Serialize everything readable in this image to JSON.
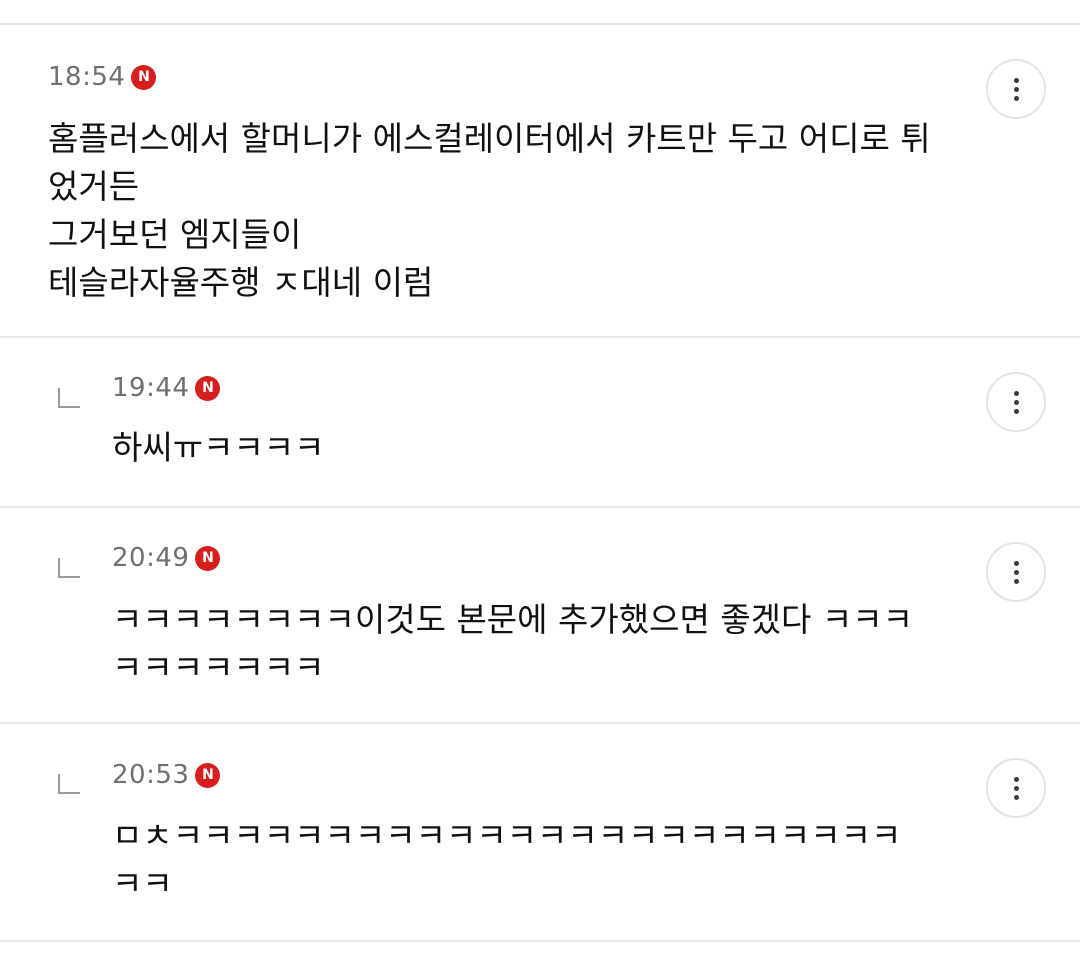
{
  "comments": [
    {
      "time": "18:54",
      "badge": "N",
      "text": "홈플러스에서 할머니가 에스컬레이터에서 카트만 두고 어디로 튀었거든\n그거보던 엠지들이\n테슬라자율주행 ㅈ대네 이럼",
      "is_reply": false
    },
    {
      "time": "19:44",
      "badge": "N",
      "text": "하씨ㅠㅋㅋㅋㅋ",
      "is_reply": true
    },
    {
      "time": "20:49",
      "badge": "N",
      "text": "ㅋㅋㅋㅋㅋㅋㅋㅋ이것도 본문에 추가했으면 좋겠다 ㅋㅋㅋㅋㅋㅋㅋㅋㅋㅋ",
      "is_reply": true
    },
    {
      "time": "20:53",
      "badge": "N",
      "text": "ㅁㅊㅋㅋㅋㅋㅋㅋㅋㅋㅋㅋㅋㅋㅋㅋㅋㅋㅋㅋㅋㅋㅋㅋㅋㅋㅋㅋ",
      "is_reply": true
    }
  ],
  "colors": {
    "badge": "#d51e1e",
    "time": "#6f6f6f",
    "divider": "#e6e6e6"
  },
  "icons": {
    "badge": "new-badge-icon",
    "more": "more-vertical-icon",
    "reply": "reply-arrow-icon"
  }
}
